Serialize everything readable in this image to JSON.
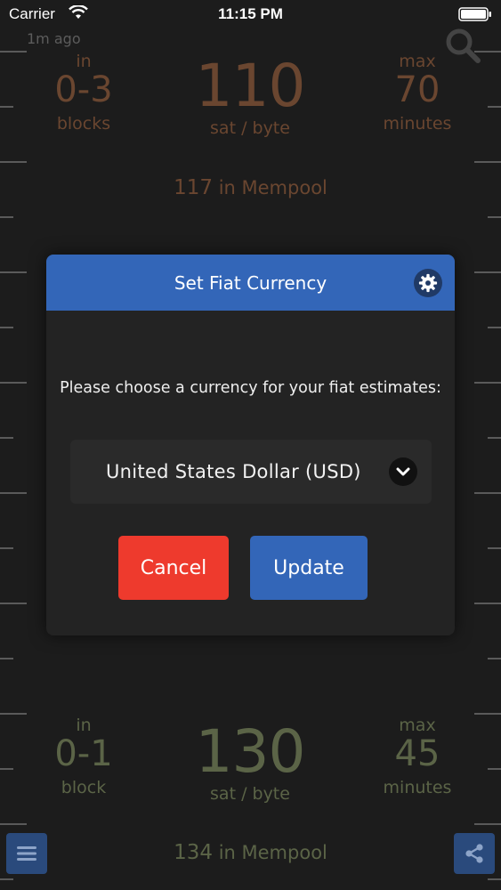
{
  "status_bar": {
    "carrier": "Carrier",
    "time": "11:15 PM"
  },
  "updated": "1m ago",
  "top_estimate": {
    "in_label": "in",
    "blocks_value": "0-3",
    "blocks_label": "blocks",
    "fee_value": "110",
    "fee_unit": "sat / byte",
    "max_label": "max",
    "minutes_value": "70",
    "minutes_label": "minutes",
    "mempool_count": "117",
    "mempool_label": "in Mempool"
  },
  "bottom_estimate": {
    "in_label": "in",
    "blocks_value": "0-1",
    "blocks_label": "block",
    "fee_value": "130",
    "fee_unit": "sat / byte",
    "max_label": "max",
    "minutes_value": "45",
    "minutes_label": "minutes",
    "mempool_count": "134",
    "mempool_label": "in Mempool"
  },
  "modal": {
    "title": "Set Fiat Currency",
    "prompt": "Please choose a currency for your fiat estimates:",
    "selected_currency": "United States Dollar (USD)",
    "cancel_label": "Cancel",
    "update_label": "Update"
  },
  "icons": {
    "search": "search-icon",
    "gear": "gear-icon",
    "chevron": "chevron-down-icon",
    "menu": "menu-icon",
    "share": "share-icon"
  },
  "colors": {
    "background": "#1c1c1c",
    "modal_header": "#3366b8",
    "cancel": "#ee3a2d",
    "update": "#3366b8",
    "top_text": "#6a4630",
    "bottom_text": "#5b6447"
  }
}
